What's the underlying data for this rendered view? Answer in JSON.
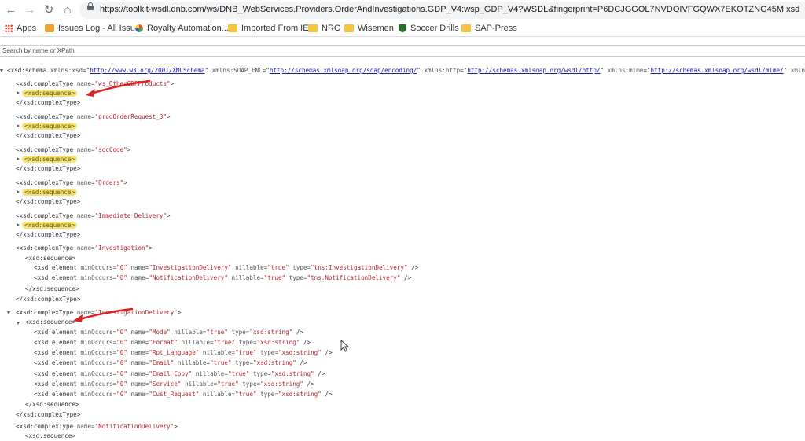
{
  "browser": {
    "url": "https://toolkit-wsdl.dnb.com/ws/DNB_WebServices.Providers.OrderAndInvestigations.GDP_V4:wsp_GDP_V4?WSDL&fingerprint=P6DCJGGOL7NVDOIVFGQWX7EKOTZNG45M.xsd",
    "bookmarks": [
      {
        "label": "Apps",
        "icon": "apps-grid-icon"
      },
      {
        "label": "Issues Log - All Issu...",
        "icon": "issues-icon"
      },
      {
        "label": "Royalty Automation...",
        "icon": "royalty-icon"
      },
      {
        "label": "Imported From IE",
        "icon": "folder-icon"
      },
      {
        "label": "NRG",
        "icon": "folder-icon"
      },
      {
        "label": "Wisemen",
        "icon": "folder-icon"
      },
      {
        "label": "Soccer Drills",
        "icon": "shield-icon"
      },
      {
        "label": "SAP-Press",
        "icon": "folder-icon"
      }
    ]
  },
  "search": {
    "placeholder": "Search by name or XPath"
  },
  "xml": {
    "schema_open": "<xsd:schema",
    "schema_attrs": [
      {
        "name": "xmlns:xsd",
        "value": "http://www.w3.org/2001/XMLSchema"
      },
      {
        "name": "xmlns:SOAP_ENC",
        "value": "http://schemas.xmlsoap.org/soap/encoding/"
      },
      {
        "name": "xmlns:http",
        "value": "http://schemas.xmlsoap.org/wsdl/http/"
      },
      {
        "name": "xmlns:mime",
        "value": "http://schemas.xmlsoap.org/wsdl/mime/"
      },
      {
        "name": "xmln",
        "value": ""
      }
    ],
    "ct_open": "<xsd:complexType",
    "ct_close": "</xsd:complexType>",
    "seq_open": "<xsd:sequence>",
    "seq_close": "</xsd:sequence>",
    "el_open": "<xsd:element",
    "self_close": " />",
    "gt": ">",
    "attr_name": "name=",
    "attr_minOccurs": "minOccurs=",
    "attr_nillable": "nillable=",
    "attr_type": "type=",
    "val_min": "\"0\"",
    "val_true": "\"true\"",
    "collapsed_complex_types": [
      "\"ws_OtherGDPProducts\"",
      "\"prodOrderRequest_3\"",
      "\"socCode\"",
      "\"Orders\"",
      "\"Immediate_Delivery\""
    ],
    "investigation": {
      "name": "\"Investigation\"",
      "elements": [
        {
          "name": "\"InvestigationDelivery\"",
          "type": "\"tns:InvestigationDelivery\""
        },
        {
          "name": "\"NotificationDelivery\"",
          "type": "\"tns:NotificationDelivery\""
        }
      ]
    },
    "investigation_delivery": {
      "name": "\"InvestigationDelivery\"",
      "elements": [
        {
          "name": "\"Mode\"",
          "type": "\"xsd:string\""
        },
        {
          "name": "\"Format\"",
          "type": "\"xsd:string\""
        },
        {
          "name": "\"Rpt_Language\"",
          "type": "\"xsd:string\""
        },
        {
          "name": "\"Email\"",
          "type": "\"xsd:string\""
        },
        {
          "name": "\"Email_Copy\"",
          "type": "\"xsd:string\""
        },
        {
          "name": "\"Service\"",
          "type": "\"xsd:string\""
        },
        {
          "name": "\"Cust_Request\"",
          "type": "\"xsd:string\""
        }
      ]
    },
    "notification_delivery": {
      "name": "\"NotificationDelivery\""
    }
  },
  "colors": {
    "annotation_arrow": "#e02020",
    "collapsed_highlight": "#f5e27a"
  }
}
